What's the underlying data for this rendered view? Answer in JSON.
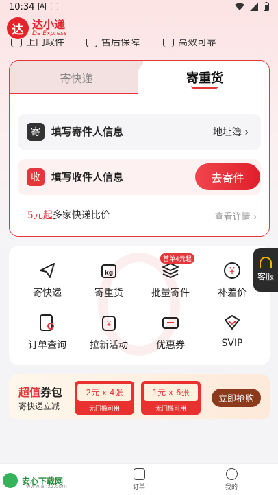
{
  "status_bar": {
    "time": "10:34"
  },
  "app": {
    "logo_char": "达",
    "name": "达小递",
    "name_en": "Da Express"
  },
  "features": [
    "上门取件",
    "售后保障",
    "高效可靠"
  ],
  "tabs": {
    "left": "寄快递",
    "right": "寄重货"
  },
  "sender": {
    "badge": "寄",
    "label": "填写寄件人信息",
    "action": "地址簿"
  },
  "receiver": {
    "badge": "收",
    "label": "填写收件人信息",
    "button": "去寄件"
  },
  "compare": {
    "highlight": "5元起",
    "text": "多家快递比价",
    "details": "查看详情"
  },
  "services": [
    {
      "label": "寄快递",
      "icon": "paper-plane-icon"
    },
    {
      "label": "寄重货",
      "icon": "weight-icon"
    },
    {
      "label": "批量寄件",
      "icon": "stack-icon"
    },
    {
      "label": "补差价",
      "icon": "yuan-icon"
    },
    {
      "label": "订单查询",
      "icon": "order-search-icon"
    },
    {
      "label": "拉新活动",
      "icon": "gift-bag-icon"
    },
    {
      "label": "优惠券",
      "icon": "ticket-icon"
    },
    {
      "label": "SVIP",
      "icon": "diamond-icon"
    }
  ],
  "batch_tag": "首单4元起",
  "customer_service": "客服",
  "coupon": {
    "title_red": "超值",
    "title_black": "券包",
    "subtitle": "寄快递立减",
    "vouchers": [
      {
        "amount": "2元 x 4张",
        "note": "无门槛可用"
      },
      {
        "amount": "1元 x 6张",
        "note": "无门槛可用"
      }
    ],
    "button": "立即抢购"
  },
  "bottom_nav": {
    "orders": "订单",
    "mine": "我的"
  },
  "watermark": {
    "name": "安心下载网",
    "url": "www.anxz.com"
  },
  "colors": {
    "brand_red": "#e5363c",
    "coupon_button": "#8b3a1c"
  }
}
